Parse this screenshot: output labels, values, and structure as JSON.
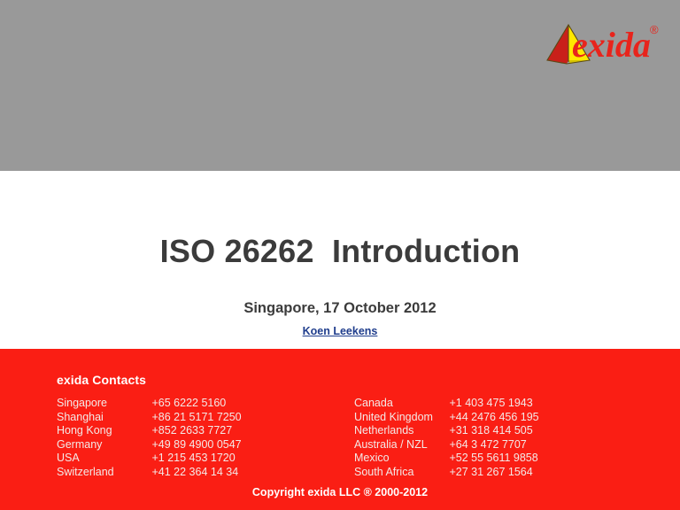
{
  "colors": {
    "top_band": "#999999",
    "contacts_band": "#fa1e14",
    "title_text": "#3b3b3b",
    "link": "#1f3d8c",
    "logo_red": "#e8241c",
    "logo_yellow": "#ffe800"
  },
  "logo": {
    "wordmark": "exida",
    "trademark": "®",
    "icon_name": "exida-pyramid-logo"
  },
  "title": {
    "main": "ISO 26262  Introduction",
    "subtitle": "Singapore, 17 October 2012",
    "presenter": "Koen Leekens"
  },
  "contacts": {
    "heading": "exida Contacts",
    "left": [
      {
        "country": "Singapore",
        "phone": "+65 6222 5160"
      },
      {
        "country": "Shanghai",
        "phone": "+86 21 5171 7250"
      },
      {
        "country": "Hong Kong",
        "phone": "+852 2633 7727"
      },
      {
        "country": "Germany",
        "phone": "+49 89 4900 0547"
      },
      {
        "country": "USA",
        "phone": "+1 215 453 1720"
      },
      {
        "country": "Switzerland",
        "phone": "+41 22 364 14 34"
      }
    ],
    "right": [
      {
        "country": "Canada",
        "phone": "+1 403 475 1943"
      },
      {
        "country": "United Kingdom",
        "phone": "+44 2476 456 195"
      },
      {
        "country": "Netherlands",
        "phone": "+31 318 414 505"
      },
      {
        "country": "Australia / NZL",
        "phone": "+64 3 472 7707"
      },
      {
        "country": "Mexico",
        "phone": "+52 55 5611 9858"
      },
      {
        "country": "South Africa",
        "phone": "+27 31 267 1564"
      }
    ]
  },
  "footer": {
    "copyright": "Copyright exida LLC ® 2000-2012"
  }
}
